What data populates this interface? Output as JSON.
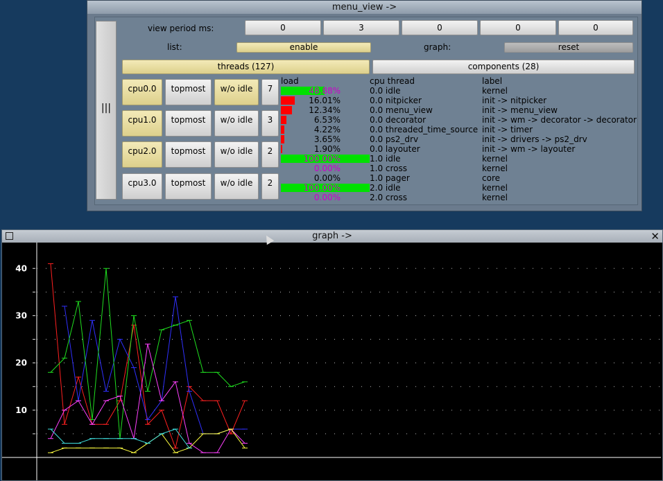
{
  "menu_window": {
    "title": "menu_view ->",
    "handle_label": "|||",
    "view_period_label": "view period ms:",
    "view_period_values": [
      "0",
      "3",
      "0",
      "0",
      "0"
    ],
    "list_label": "list:",
    "list_value": "enable",
    "graph_label": "graph:",
    "graph_value": "reset",
    "tab_threads": "threads (127)",
    "tab_components": "components (28)",
    "cpus": [
      {
        "name": "cpu0.0",
        "topmost": "topmost",
        "idle": "w/o idle",
        "count": "7"
      },
      {
        "name": "cpu1.0",
        "topmost": "topmost",
        "idle": "w/o idle",
        "count": "3"
      },
      {
        "name": "cpu2.0",
        "topmost": "topmost",
        "idle": "w/o idle",
        "count": "2"
      },
      {
        "name": "cpu3.0",
        "topmost": "topmost",
        "idle": "w/o idle",
        "count": "2"
      }
    ],
    "table_headers": {
      "load": "load",
      "thread": "cpu thread",
      "label": "label"
    },
    "rows": [
      {
        "pct": "48.88%",
        "load": 48.88,
        "thread": "0.0 idle",
        "label": "kernel",
        "bar_color": "#00e000",
        "pct_color": "magenta"
      },
      {
        "pct": "16.01%",
        "load": 16.01,
        "thread": "0.0 nitpicker",
        "label": "init -> nitpicker",
        "bar_color": "#ff0000",
        "pct_color": "black"
      },
      {
        "pct": "12.34%",
        "load": 12.34,
        "thread": "0.0 menu_view",
        "label": "init -> menu_view",
        "bar_color": "#ff0000",
        "pct_color": "black"
      },
      {
        "pct": "6.53%",
        "load": 6.53,
        "thread": "0.0 decorator",
        "label": "init -> wm -> decorator -> decorator",
        "bar_color": "#ff0000",
        "pct_color": "black"
      },
      {
        "pct": "4.22%",
        "load": 4.22,
        "thread": "0.0 threaded_time_source",
        "label": "init -> timer",
        "bar_color": "#ff0000",
        "pct_color": "black"
      },
      {
        "pct": "3.65%",
        "load": 3.65,
        "thread": "0.0 ps2_drv",
        "label": "init -> drivers -> ps2_drv",
        "bar_color": "#ff0000",
        "pct_color": "black"
      },
      {
        "pct": "1.90%",
        "load": 1.9,
        "thread": "0.0 layouter",
        "label": "init -> wm -> layouter",
        "bar_color": "#ff0000",
        "pct_color": "black"
      },
      {
        "pct": "100.00%",
        "load": 100,
        "thread": "1.0 idle",
        "label": "kernel",
        "bar_color": "#00e000",
        "pct_color": "magenta"
      },
      {
        "pct": "0.00%",
        "load": 0,
        "thread": "1.0 cross",
        "label": "kernel",
        "bar_color": "#00e000",
        "pct_color": "magenta"
      },
      {
        "pct": "0.00%",
        "load": 0,
        "thread": "1.0 pager",
        "label": "core",
        "bar_color": "#ff0000",
        "pct_color": "black"
      },
      {
        "pct": "100.00%",
        "load": 100,
        "thread": "2.0 idle",
        "label": "kernel",
        "bar_color": "#00e000",
        "pct_color": "magenta"
      },
      {
        "pct": "0.00%",
        "load": 0,
        "thread": "2.0 cross",
        "label": "kernel",
        "bar_color": "#00e000",
        "pct_color": "magenta"
      }
    ]
  },
  "graph_window": {
    "title": "graph ->",
    "close_icon": "close-icon",
    "chart_data": {
      "type": "line",
      "y_ticks": [
        "10",
        "20",
        "30",
        "40"
      ],
      "ylim": [
        0,
        44
      ],
      "xlim": [
        0,
        30
      ],
      "grid": "dotted horizontal lines every 5",
      "series": [
        {
          "color": "#ff2020",
          "points": [
            [
              1,
              41
            ],
            [
              3,
              7
            ],
            [
              5,
              17
            ],
            [
              7,
              7
            ],
            [
              9,
              7
            ],
            [
              11,
              12
            ],
            [
              13,
              28
            ],
            [
              15,
              7
            ],
            [
              17,
              10
            ],
            [
              19,
              2
            ],
            [
              21,
              15
            ],
            [
              23,
              12
            ],
            [
              25,
              12
            ],
            [
              27,
              5
            ],
            [
              29,
              12
            ]
          ]
        },
        {
          "color": "#3030ff",
          "points": [
            [
              3,
              32
            ],
            [
              5,
              12
            ],
            [
              7,
              29
            ],
            [
              9,
              14
            ],
            [
              11,
              25
            ],
            [
              13,
              19
            ],
            [
              15,
              8
            ],
            [
              17,
              12
            ],
            [
              19,
              34
            ],
            [
              21,
              14
            ],
            [
              23,
              5
            ],
            [
              25,
              5
            ],
            [
              27,
              6
            ],
            [
              29,
              6
            ]
          ]
        },
        {
          "color": "#20e020",
          "points": [
            [
              1,
              18
            ],
            [
              3,
              21
            ],
            [
              5,
              33
            ],
            [
              7,
              8
            ],
            [
              9,
              40
            ],
            [
              11,
              4
            ],
            [
              13,
              30
            ],
            [
              15,
              14
            ],
            [
              17,
              27
            ],
            [
              19,
              28
            ],
            [
              21,
              29
            ],
            [
              23,
              18
            ],
            [
              25,
              18
            ],
            [
              27,
              15
            ],
            [
              29,
              16
            ]
          ]
        },
        {
          "color": "#ff40ff",
          "points": [
            [
              1,
              4
            ],
            [
              3,
              10
            ],
            [
              5,
              12
            ],
            [
              7,
              7
            ],
            [
              9,
              12
            ],
            [
              11,
              13
            ],
            [
              13,
              4
            ],
            [
              15,
              24
            ],
            [
              17,
              12
            ],
            [
              19,
              16
            ],
            [
              21,
              3
            ],
            [
              23,
              1
            ],
            [
              25,
              1
            ],
            [
              27,
              6
            ],
            [
              29,
              3
            ]
          ]
        },
        {
          "color": "#ffff40",
          "points": [
            [
              1,
              1
            ],
            [
              3,
              2
            ],
            [
              5,
              2
            ],
            [
              7,
              2
            ],
            [
              9,
              2
            ],
            [
              11,
              2
            ],
            [
              13,
              1
            ],
            [
              15,
              3
            ],
            [
              17,
              5
            ],
            [
              19,
              1
            ],
            [
              21,
              2
            ],
            [
              23,
              5
            ],
            [
              25,
              5
            ],
            [
              27,
              6
            ],
            [
              29,
              2
            ]
          ]
        },
        {
          "color": "#40e0e0",
          "points": [
            [
              1,
              6
            ],
            [
              3,
              3
            ],
            [
              5,
              3
            ],
            [
              7,
              4
            ],
            [
              9,
              4
            ],
            [
              11,
              4
            ],
            [
              13,
              4
            ],
            [
              15,
              3
            ],
            [
              17,
              5
            ],
            [
              19,
              6
            ],
            [
              21,
              2
            ]
          ]
        }
      ]
    }
  }
}
